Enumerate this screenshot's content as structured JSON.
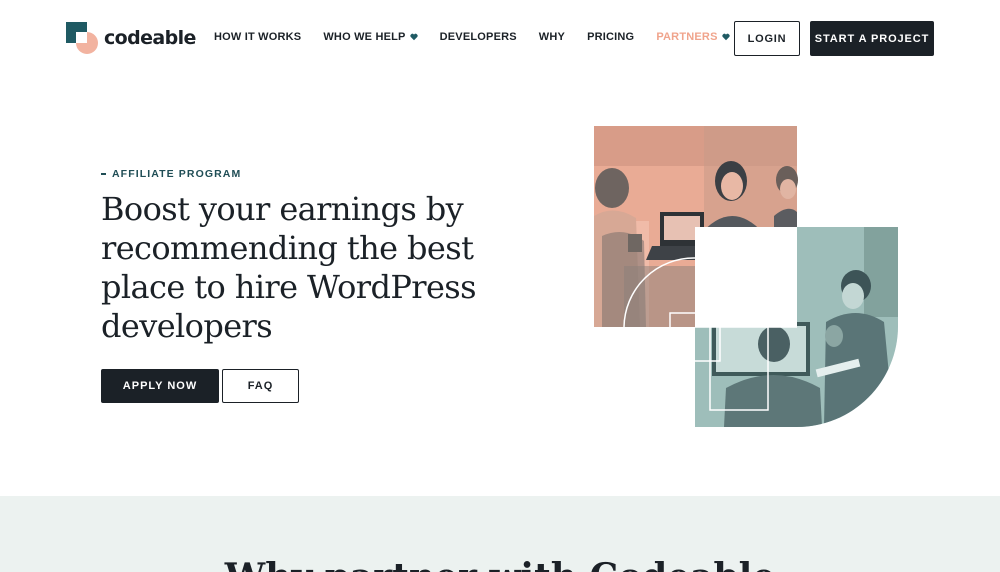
{
  "brand": {
    "name": "codeable"
  },
  "nav": {
    "items": [
      {
        "label": "HOW IT WORKS",
        "dropdown": false,
        "active": false
      },
      {
        "label": "WHO WE HELP",
        "dropdown": true,
        "active": false
      },
      {
        "label": "DEVELOPERS",
        "dropdown": false,
        "active": false
      },
      {
        "label": "WHY",
        "dropdown": false,
        "active": false
      },
      {
        "label": "PRICING",
        "dropdown": false,
        "active": false
      },
      {
        "label": "PARTNERS",
        "dropdown": true,
        "active": true
      }
    ],
    "login_label": "LOGIN",
    "cta_label": "START A PROJECT"
  },
  "hero": {
    "eyebrow": "AFFILIATE PROGRAM",
    "headline": "Boost your earnings by recommending the best place to hire WordPress developers",
    "primary_button": "APPLY NOW",
    "secondary_button": "FAQ"
  },
  "band": {
    "heading": "Why partner with Codeable"
  },
  "colors": {
    "dark": "#1b2127",
    "teal": "#1f5a63",
    "peach": "#f2b3a0",
    "active_nav": "#f0a48c",
    "sage": "#9fbdb8",
    "band_bg": "#ecf2f0"
  },
  "icons": {
    "dropdown": "heart-icon"
  }
}
